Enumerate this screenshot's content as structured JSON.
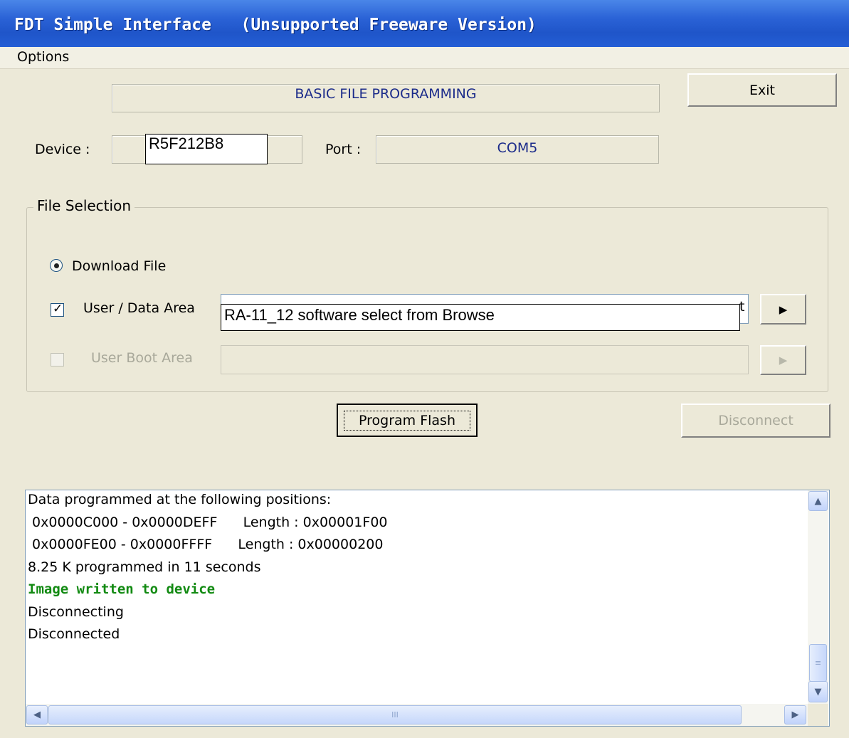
{
  "window": {
    "title": "FDT Simple Interface   (Unsupported Freeware Version)"
  },
  "menu": {
    "options_label": "Options"
  },
  "header": {
    "mode_label": "BASIC FILE PROGRAMMING",
    "exit_label": "Exit"
  },
  "device": {
    "label": "Device :",
    "value": "R5F212B8"
  },
  "port": {
    "label": "Port :",
    "value": "COM5"
  },
  "file_selection": {
    "title": "File Selection",
    "download_file_label": "Download File",
    "user_data_area_label": "User / Data Area",
    "user_data_area_checked": true,
    "user_data_area_path_overlay": "RA-11_12 software select from Browse",
    "user_data_area_path_tail": "t",
    "user_boot_area_label": "User Boot Area",
    "user_boot_area_checked": false,
    "browse_arrow": "▶"
  },
  "actions": {
    "program_flash_label": "Program Flash",
    "disconnect_label": "Disconnect"
  },
  "log": {
    "lines": [
      "Data programmed at the following positions:",
      " 0x0000C000 - 0x0000DEFF      Length : 0x00001F00",
      " 0x0000FE00 - 0x0000FFFF      Length : 0x00000200",
      "8.25 K programmed in 11 seconds",
      "Image written to device",
      "Disconnecting",
      "Disconnected"
    ],
    "highlight_color": "#128a12"
  },
  "scroll": {
    "up": "▲",
    "down": "▼",
    "left": "◀",
    "right": "▶",
    "grip": "III"
  }
}
